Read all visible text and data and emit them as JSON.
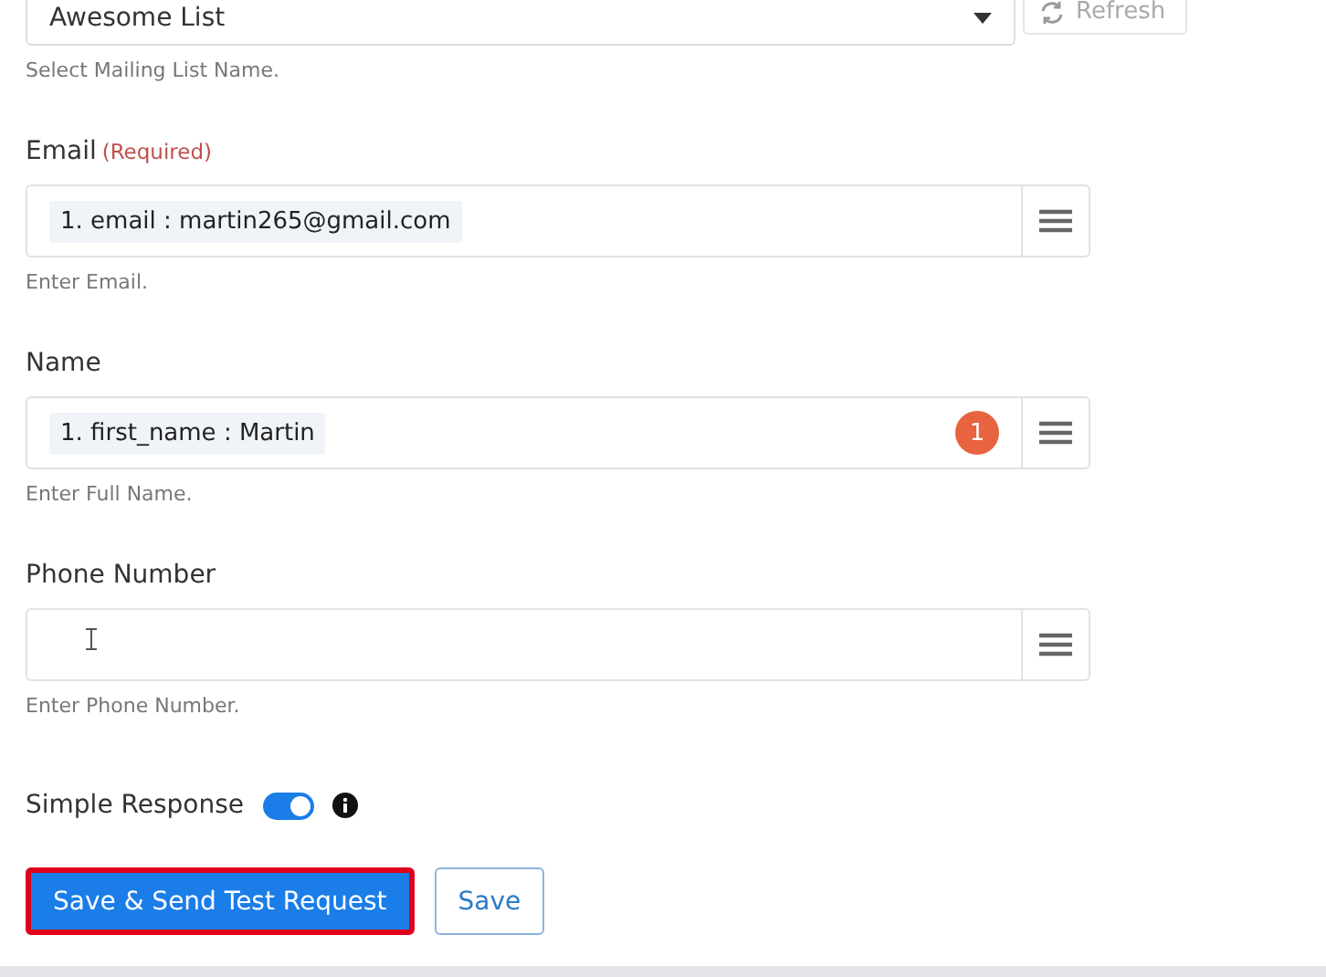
{
  "mailing_list": {
    "value": "Awesome List",
    "refresh": "Refresh",
    "hint": "Select Mailing List Name."
  },
  "fields": [
    {
      "label": "Email",
      "required": "(Required)",
      "tag": "1. email : martin265@gmail.com",
      "hint": "Enter Email.",
      "cursor": false
    },
    {
      "label": "Name",
      "tag": "1. first_name : Martin",
      "badge": "1",
      "hint": "Enter Full Name.",
      "cursor": false
    },
    {
      "label": "Phone Number",
      "hint": "Enter Phone Number.",
      "cursor": true
    }
  ],
  "simple_response": {
    "label": "Simple Response",
    "on": true
  },
  "buttons": [
    {
      "label": "Save & Send Test Request",
      "kind": "primary",
      "highlighted": true
    },
    {
      "label": "Save",
      "kind": "outline",
      "highlighted": false
    }
  ]
}
